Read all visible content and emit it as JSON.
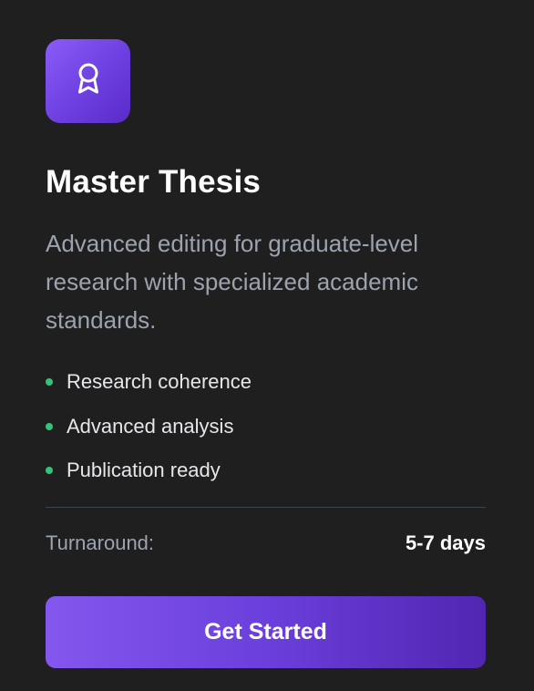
{
  "card": {
    "icon": "award-ribbon-icon",
    "title": "Master Thesis",
    "description": "Advanced editing for graduate-level research with specialized academic standards.",
    "features": [
      "Research coherence",
      "Advanced analysis",
      "Publication ready"
    ],
    "turnaround_label": "Turnaround:",
    "turnaround_value": "5-7 days",
    "cta_label": "Get Started"
  },
  "colors": {
    "background": "#1f1f1f",
    "accent_purple": "#7c4ff0",
    "bullet_green": "#34c37a",
    "muted_text": "#9ca3af"
  }
}
